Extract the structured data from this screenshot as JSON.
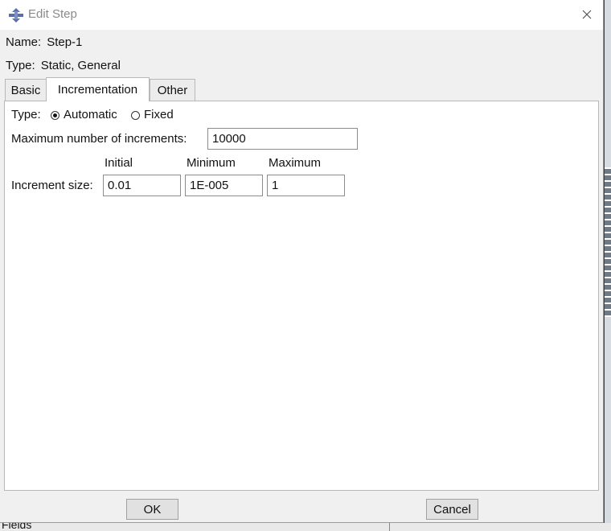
{
  "background": {
    "bottom_label": "Fields"
  },
  "dialog": {
    "title": "Edit Step",
    "close_glyph": "×",
    "name_label": "Name:",
    "name_value": "Step-1",
    "type_label": "Type:",
    "type_value": "Static, General"
  },
  "tabs": [
    {
      "label": "Basic",
      "active": false
    },
    {
      "label": "Incrementation",
      "active": true
    },
    {
      "label": "Other",
      "active": false
    }
  ],
  "incrementation": {
    "type_label": "Type:",
    "type_options": [
      {
        "label": "Automatic",
        "selected": true
      },
      {
        "label": "Fixed",
        "selected": false
      }
    ],
    "max_increments_label": "Maximum number of increments:",
    "max_increments_value": "10000",
    "increment_size_label": "Increment size:",
    "columns": [
      "Initial",
      "Minimum",
      "Maximum"
    ],
    "values": [
      "0.01",
      "1E-005",
      "1"
    ]
  },
  "buttons": {
    "ok": "OK",
    "cancel": "Cancel"
  },
  "icons": {
    "app": "abaqus-step-icon",
    "close": "close-icon"
  },
  "colors": {
    "title_text": "#8a8a8a",
    "dialog_bg": "#f0f0f0",
    "panel_bg": "#ffffff",
    "icon_accent": "#5b6ea6"
  }
}
